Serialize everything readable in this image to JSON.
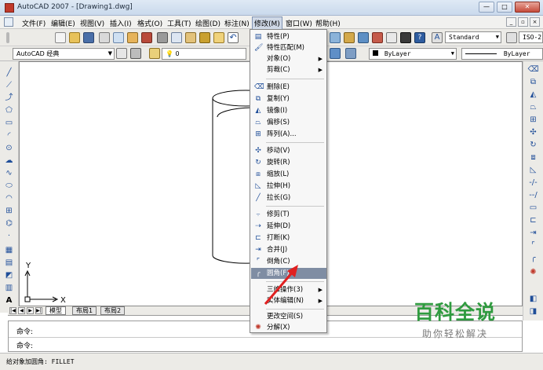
{
  "window": {
    "title": "AutoCAD 2007 - [Drawing1.dwg]"
  },
  "menubar": {
    "items": [
      {
        "label": "文件(F)"
      },
      {
        "label": "编辑(E)"
      },
      {
        "label": "视图(V)"
      },
      {
        "label": "插入(I)"
      },
      {
        "label": "格式(O)"
      },
      {
        "label": "工具(T)"
      },
      {
        "label": "绘图(D)"
      },
      {
        "label": "标注(N)"
      },
      {
        "label": "修改(M)",
        "active": true
      },
      {
        "label": "窗口(W)"
      },
      {
        "label": "帮助(H)"
      }
    ]
  },
  "toolbar1": {
    "text_style": "Standard",
    "dim_style": "ISO-2"
  },
  "toolbar2": {
    "workspace": "AutoCAD 经典",
    "layer": "0",
    "color": "ByLayer",
    "linetype": "ByLayer"
  },
  "modify_menu": {
    "items": [
      {
        "label": "特性(P)",
        "icon": "properties-icon"
      },
      {
        "label": "特性匹配(M)",
        "icon": "match-properties-icon"
      },
      {
        "label": "对象(O)",
        "submenu": true
      },
      {
        "label": "剪裁(C)",
        "submenu": true
      },
      {
        "label": "删除(E)",
        "icon": "erase-icon"
      },
      {
        "label": "复制(Y)",
        "icon": "copy-icon"
      },
      {
        "label": "镜像(I)",
        "icon": "mirror-icon"
      },
      {
        "label": "偏移(S)",
        "icon": "offset-icon"
      },
      {
        "label": "阵列(A)...",
        "icon": "array-icon"
      },
      {
        "label": "移动(V)",
        "icon": "move-icon"
      },
      {
        "label": "旋转(R)",
        "icon": "rotate-icon"
      },
      {
        "label": "缩放(L)",
        "icon": "scale-icon"
      },
      {
        "label": "拉伸(H)",
        "icon": "stretch-icon"
      },
      {
        "label": "拉长(G)",
        "icon": "lengthen-icon"
      },
      {
        "label": "修剪(T)",
        "icon": "trim-icon"
      },
      {
        "label": "延伸(D)",
        "icon": "extend-icon"
      },
      {
        "label": "打断(K)",
        "icon": "break-icon"
      },
      {
        "label": "合并(J)",
        "icon": "join-icon"
      },
      {
        "label": "倒角(C)",
        "icon": "chamfer-icon"
      },
      {
        "label": "圆角(F)",
        "icon": "fillet-icon",
        "highlighted": true
      },
      {
        "label": "三维操作(3)",
        "submenu": true
      },
      {
        "label": "实体编辑(N)",
        "submenu": true
      },
      {
        "label": "更改空间(S)",
        "icon": "change-space-icon"
      },
      {
        "label": "分解(X)",
        "icon": "explode-icon"
      }
    ]
  },
  "ucs": {
    "x_label": "X",
    "y_label": "Y"
  },
  "layout_tabs": [
    {
      "label": "模型",
      "active": true
    },
    {
      "label": "布局1"
    },
    {
      "label": "布局2"
    }
  ],
  "command": {
    "line1": "命令:",
    "line2": "命令:"
  },
  "status": {
    "text": "给对象加圆角:  FILLET"
  },
  "watermark": {
    "title": "百科全说",
    "subtitle": "助你轻松解决"
  },
  "colors": {
    "accent": "#1f4e99",
    "highlight": "#7f8da3",
    "watermark": "#2f9b3f",
    "arrow": "#e02020"
  }
}
